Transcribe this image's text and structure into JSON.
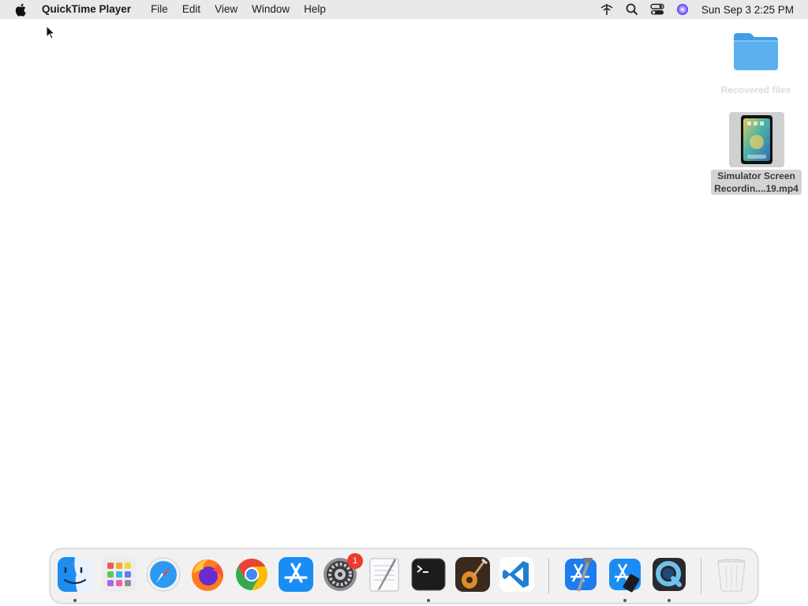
{
  "menubar": {
    "app_name": "QuickTime Player",
    "menus": [
      "File",
      "Edit",
      "View",
      "Window",
      "Help"
    ],
    "clock": "Sun Sep 3  2:25 PM",
    "status_icons": [
      "network-icon",
      "search-icon",
      "control-center-icon",
      "siri-icon"
    ]
  },
  "desktop": {
    "items": [
      {
        "label": "Recovered files",
        "icon": "folder-icon",
        "selected": false
      },
      {
        "label_line1": "Simulator Screen",
        "label_line2": "Recordin....19.mp4",
        "icon": "video-thumbnail",
        "selected": true
      }
    ]
  },
  "dock": {
    "apps": [
      {
        "name": "Finder",
        "icon": "finder-icon",
        "running": true
      },
      {
        "name": "Launchpad",
        "icon": "launchpad-icon",
        "running": false
      },
      {
        "name": "Safari",
        "icon": "safari-icon",
        "running": false
      },
      {
        "name": "Firefox",
        "icon": "firefox-icon",
        "running": false
      },
      {
        "name": "Chrome",
        "icon": "chrome-icon",
        "running": false
      },
      {
        "name": "App Store",
        "icon": "app-store-icon",
        "running": false
      },
      {
        "name": "System Settings",
        "icon": "settings-icon",
        "running": false,
        "badge": "1"
      },
      {
        "name": "TextEdit",
        "icon": "textedit-icon",
        "running": false
      },
      {
        "name": "Terminal",
        "icon": "terminal-icon",
        "running": true
      },
      {
        "name": "GarageBand",
        "icon": "garageband-icon",
        "running": false
      },
      {
        "name": "Visual Studio Code",
        "icon": "vscode-icon",
        "running": false
      },
      {
        "name": "Xcode",
        "icon": "xcode-icon",
        "running": false
      },
      {
        "name": "Simulator",
        "icon": "simulator-icon",
        "running": true
      },
      {
        "name": "QuickTime Player",
        "icon": "quicktime-icon",
        "running": true
      },
      {
        "name": "Trash",
        "icon": "trash-icon",
        "running": false
      }
    ],
    "colors": {
      "badge": "#ef3b2c",
      "folder": "#5ab0ef"
    }
  }
}
